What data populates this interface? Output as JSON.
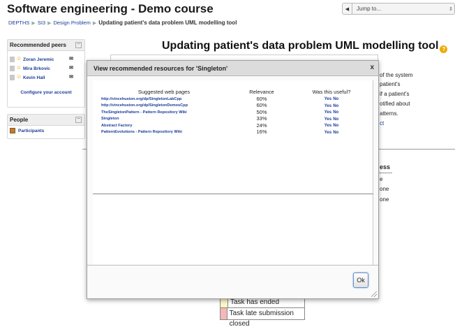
{
  "header": {
    "site_title": "Software engineering - Demo course",
    "jump_to": "Jump to...",
    "breadcrumb": [
      "DEPTHS",
      "SI3",
      "Design Problem",
      "Updating patient's data problem UML modelling tool"
    ]
  },
  "sidebar": {
    "recommended_peers": {
      "title": "Recommended peers",
      "peers": [
        "Zoran Jeremic",
        "Mira Brkovic",
        "Kevin Hall"
      ],
      "configure_link": "Configure your account"
    },
    "people": {
      "title": "People",
      "items": [
        "Participants"
      ]
    }
  },
  "main": {
    "page_title": "Updating patient's data problem UML modelling tool",
    "intro_peek": [
      "of the system",
      "patient's",
      "if a patient's",
      "otified about",
      "atterns.",
      "ct"
    ],
    "table_peek": {
      "header": "ess",
      "rows": [
        "e",
        "one",
        "one"
      ]
    },
    "legend": [
      {
        "label": "Task has ended",
        "color": "#fdf7c7"
      },
      {
        "label": "Task late submission closed",
        "color": "#f4b8b8"
      }
    ]
  },
  "modal": {
    "title": "View recommended resources for 'Singleton'",
    "close": "x",
    "columns": [
      "Suggested web pages",
      "Relevance",
      "Was this useful?"
    ],
    "rows": [
      {
        "page": "http://vincehuston.org/dp/SingletonLabCpp",
        "relevance": "60%",
        "yes": "Yes",
        "no": "No"
      },
      {
        "page": "http://vincehuston.org/dp/SingletonDemosCpp",
        "relevance": "60%",
        "yes": "Yes",
        "no": "No"
      },
      {
        "page": "TheSingletonPattern - Pattern Repository Wiki",
        "relevance": "50%",
        "yes": "Yes",
        "no": "No"
      },
      {
        "page": "Singleton",
        "relevance": "33%",
        "yes": "Yes",
        "no": "No"
      },
      {
        "page": "Abstract Factory",
        "relevance": "24%",
        "yes": "Yes",
        "no": "No"
      },
      {
        "page": "PatternEvolutions - Pattern Repository Wiki",
        "relevance": "16%",
        "yes": "Yes",
        "no": "No"
      }
    ],
    "ok_label": "Ok"
  },
  "colors": {
    "link": "#1a3d9a",
    "modal_header": "#dcdcdc",
    "ok_border": "#6a8fcc"
  }
}
